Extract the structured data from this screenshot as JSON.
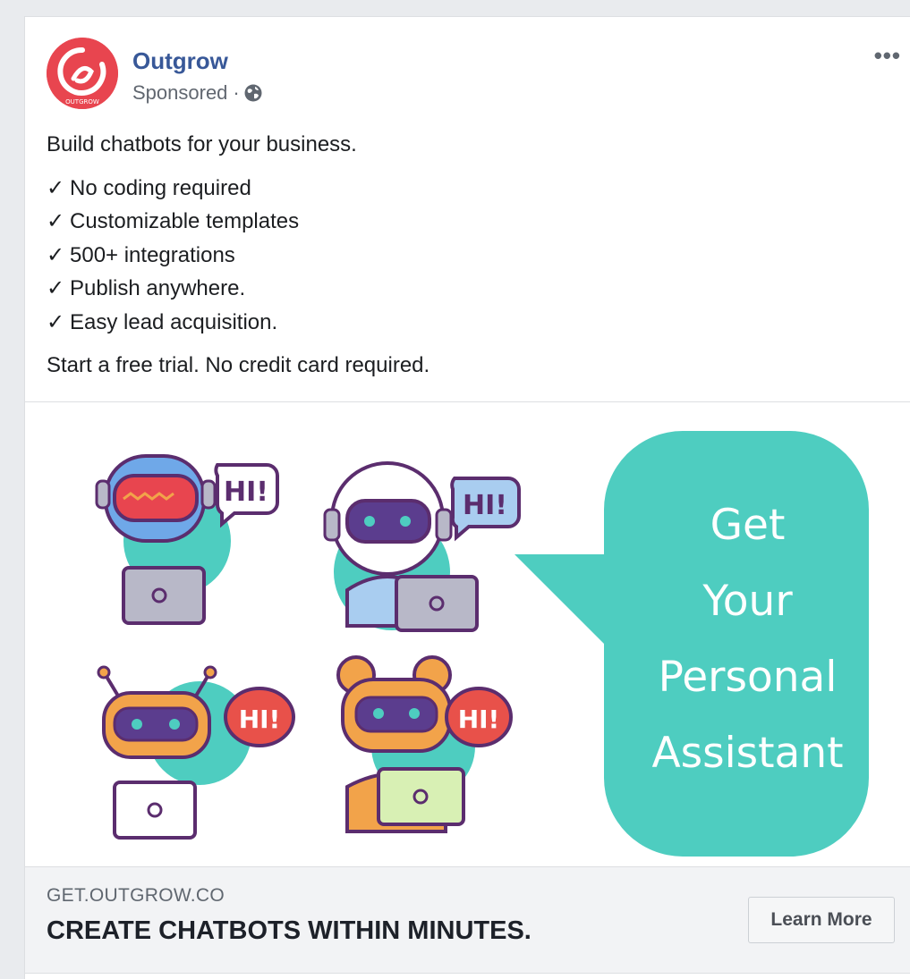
{
  "post": {
    "page_name": "Outgrow",
    "sponsored_label": "Sponsored",
    "separator": "·",
    "logo_text": "OUTGROW",
    "more_label": "•••",
    "intro": "Build chatbots for your business.",
    "check_glyph": "✓",
    "bullets": [
      "No coding required",
      "Customizable templates",
      "500+ integrations",
      "Publish anywhere.",
      "Easy lead acquisition."
    ],
    "closing": "Start a free trial. No credit card required."
  },
  "media": {
    "bubble_lines": [
      "Get",
      "Your",
      "Personal",
      "Assistant"
    ],
    "robot_greeting": "HI!",
    "colors": {
      "teal": "#4ecdc0",
      "purple": "#5b2d6e",
      "blue_robot": "#6fa8e8",
      "orange_robot": "#f2a34a",
      "red_bubble": "#e8514a"
    }
  },
  "link": {
    "domain": "GET.OUTGROW.CO",
    "headline": "CREATE CHATBOTS WITHIN MINUTES.",
    "cta_label": "Learn More"
  },
  "colors": {
    "page_bg": "#e9ebee",
    "link_blue": "#385898",
    "brand_red": "#e8454f"
  }
}
